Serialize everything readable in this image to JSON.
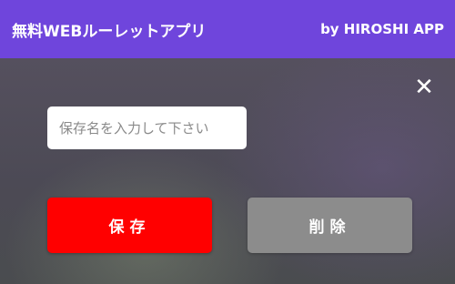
{
  "app_bar": {
    "title": "無料WEBルーレットアプリ",
    "byline": "by HIROSHI APP",
    "background_color": "#6f45dc"
  },
  "dialog": {
    "close_icon": "close-icon",
    "close_glyph": "✕",
    "name_input": {
      "value": "",
      "placeholder": "保存名を入力して下さい"
    },
    "save_button": {
      "label": "保存",
      "color": "#ff0000"
    },
    "delete_button": {
      "label": "削除",
      "color": "#8c8c8c"
    }
  }
}
